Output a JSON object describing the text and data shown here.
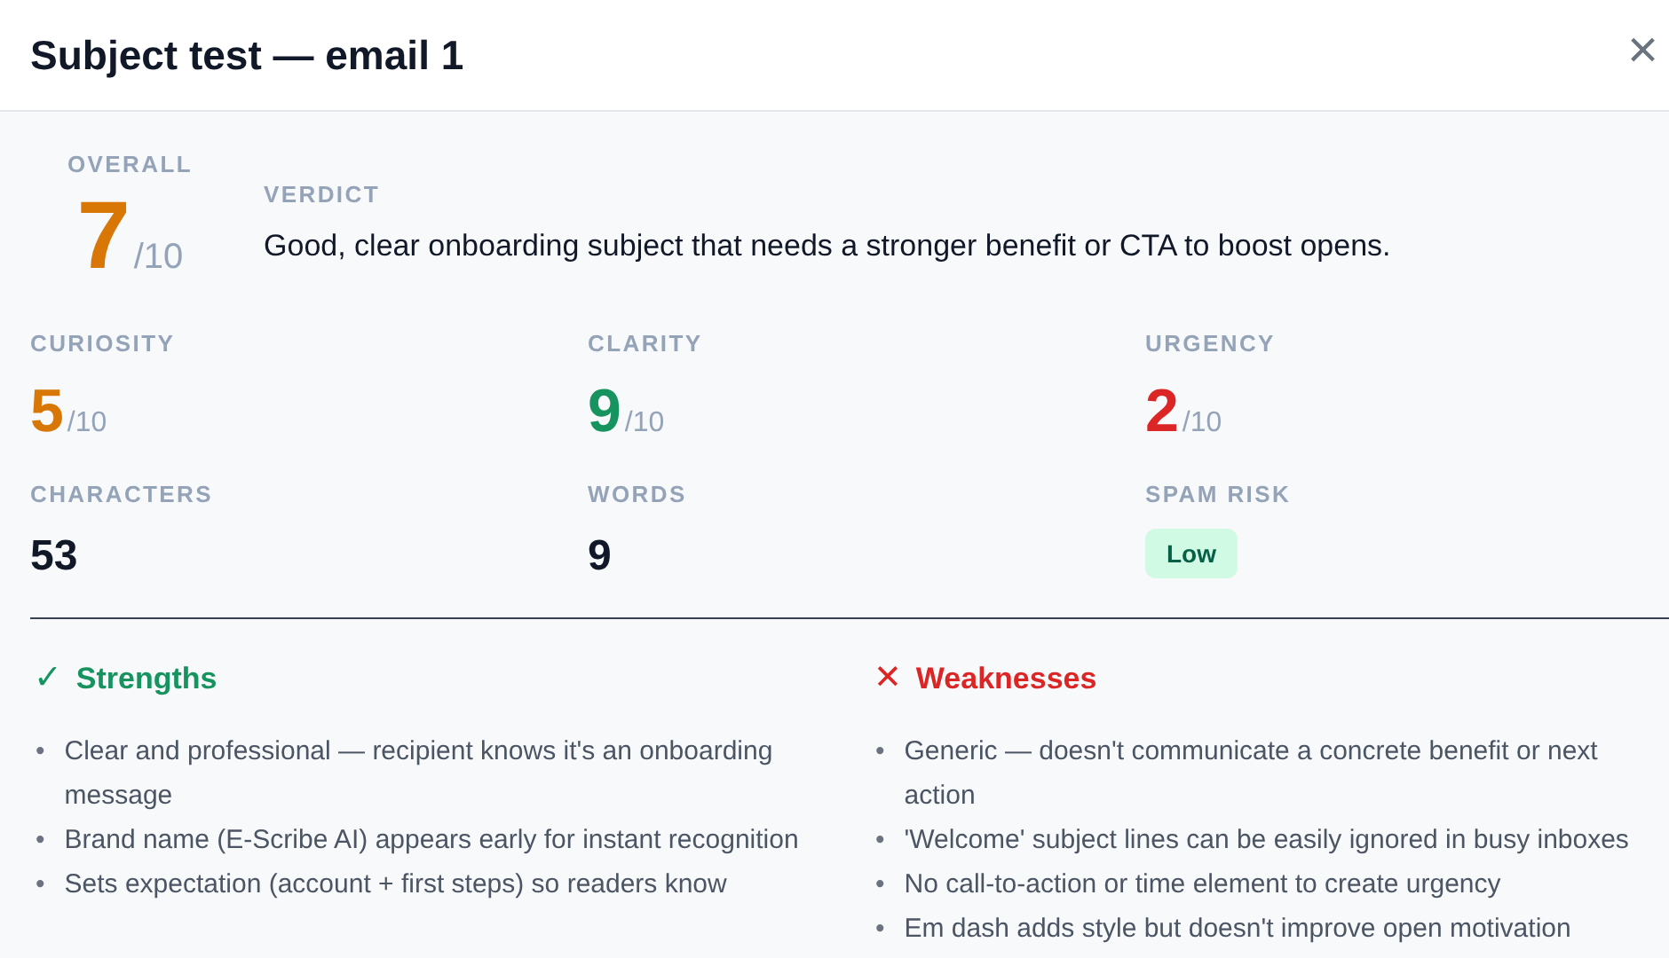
{
  "window": {
    "title": "Subject test — email 1",
    "close": "×"
  },
  "overall": {
    "label": "OVERALL",
    "score": "7",
    "max": "/10",
    "color": "#d97706"
  },
  "verdict": {
    "label": "VERDICT",
    "text": "Good, clear onboarding subject that needs a stronger benefit or CTA to boost opens."
  },
  "scores": [
    {
      "label": "CURIOSITY",
      "score": "5",
      "max": "/10",
      "color": "#d97706"
    },
    {
      "label": "CLARITY",
      "score": "9",
      "max": "/10",
      "color": "#16935f"
    },
    {
      "label": "URGENCY",
      "score": "2",
      "max": "/10",
      "color": "#dc2626"
    }
  ],
  "stats": [
    {
      "kind": "number",
      "label": "CHARACTERS",
      "value": "53"
    },
    {
      "kind": "number",
      "label": "WORDS",
      "value": "9"
    },
    {
      "kind": "badge",
      "label": "SPAM RISK",
      "value": "Low"
    }
  ],
  "strengths": {
    "icon": "✓",
    "bullet": "•",
    "title": "Strengths",
    "items": [
      "Clear and professional — recipient knows it's an onboarding message",
      "Brand name (E-Scribe AI) appears early for instant recognition",
      "Sets expectation (account + first steps) so readers know"
    ]
  },
  "weaknesses": {
    "icon": "✕",
    "bullet": "•",
    "title": "Weaknesses",
    "items": [
      "Generic — doesn't communicate a concrete benefit or next action",
      "'Welcome' subject lines can be easily ignored in busy inboxes",
      "No call-to-action or time element to create urgency",
      "Em dash adds style but doesn't improve open motivation"
    ]
  }
}
